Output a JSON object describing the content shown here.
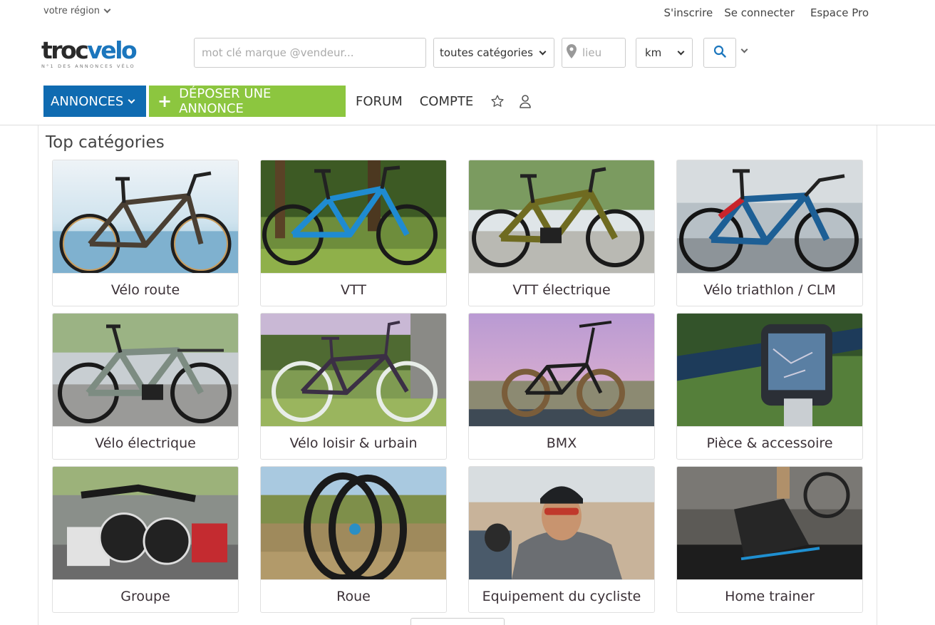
{
  "header": {
    "region": "votre région",
    "links": {
      "signup": "S'inscrire",
      "login": "Se connecter",
      "pro": "Espace Pro"
    },
    "logo": {
      "part1": "troc",
      "part2": "velo",
      "tagline": "N°1 DES ANNONCES VÉLO"
    }
  },
  "search": {
    "keyword_placeholder": "mot clé marque @vendeur...",
    "category_value": "toutes catégories",
    "location_placeholder": "lieu",
    "distance_value": "km"
  },
  "nav": {
    "annonces": "ANNONCES",
    "deposer": "DÉPOSER UNE ANNONCE",
    "forum": "FORUM",
    "compte": "COMPTE"
  },
  "main": {
    "title": "Top catégories",
    "categories": [
      {
        "label": "Vélo route"
      },
      {
        "label": "VTT"
      },
      {
        "label": "VTT électrique"
      },
      {
        "label": "Vélo triathlon / CLM"
      },
      {
        "label": "Vélo électrique"
      },
      {
        "label": "Vélo loisir & urbain"
      },
      {
        "label": "BMX"
      },
      {
        "label": "Pièce & accessoire"
      },
      {
        "label": "Groupe"
      },
      {
        "label": "Roue"
      },
      {
        "label": "Equipement du cycliste"
      },
      {
        "label": "Home trainer"
      }
    ]
  },
  "colors": {
    "brand_blue": "#0f6bb1",
    "brand_green": "#8cc63f",
    "logo_blue": "#1b76bd"
  },
  "icons": {
    "star": "star-icon",
    "user": "user-icon",
    "search": "search-icon",
    "location": "map-pin-icon"
  }
}
